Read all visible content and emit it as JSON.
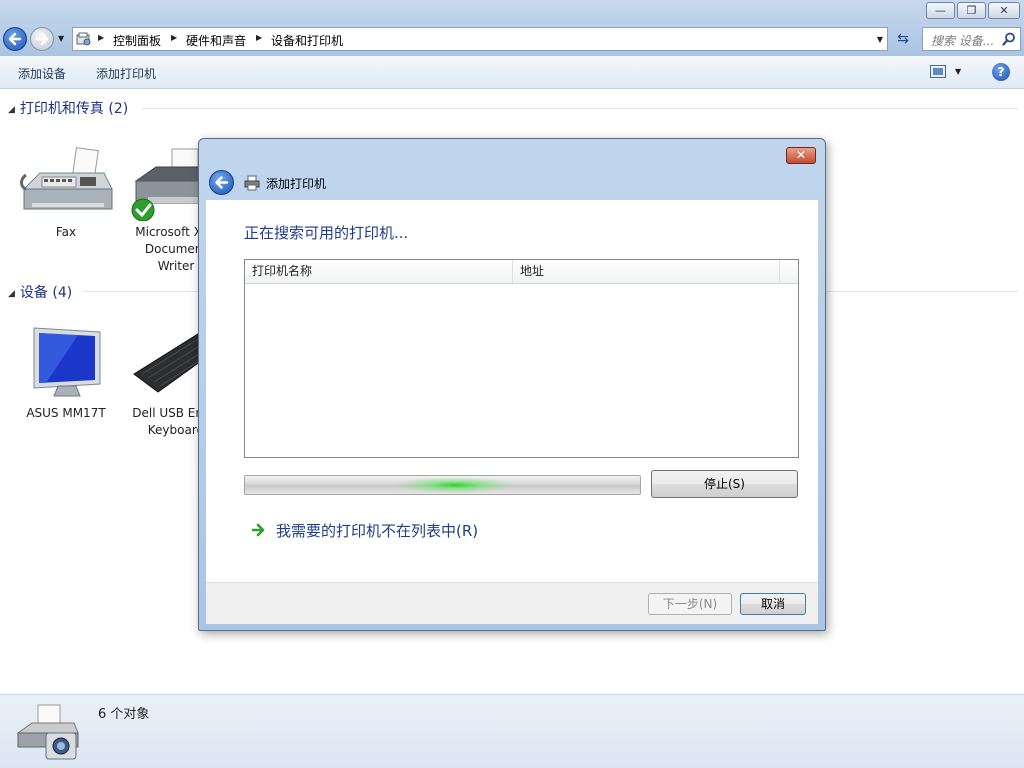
{
  "window": {
    "minimize_glyph": "—",
    "restore_glyph": "❐",
    "close_glyph": "✕"
  },
  "address_bar": {
    "breadcrumbs": [
      "控制面板",
      "硬件和声音",
      "设备和打印机"
    ],
    "search_placeholder": "搜索 设备...",
    "icons": [
      "back-arrow-icon",
      "forward-arrow-icon",
      "control-panel-icon",
      "refresh-icon",
      "search-icon"
    ]
  },
  "command_bar": {
    "add_device": "添加设备",
    "add_printer": "添加打印机",
    "help_glyph": "?"
  },
  "groups": [
    {
      "title": "打印机和传真 (2)",
      "devices": [
        {
          "label_lines": [
            "Fax"
          ],
          "icon": "fax-icon"
        },
        {
          "label_lines": [
            "Microsoft XPS",
            "Document",
            "Writer"
          ],
          "icon": "printer-icon",
          "default": true
        }
      ]
    },
    {
      "title": "设备 (4)",
      "devices": [
        {
          "label_lines": [
            "ASUS MM17T"
          ],
          "icon": "monitor-icon"
        },
        {
          "label_lines": [
            "Dell USB Entry",
            "Keyboard"
          ],
          "icon": "keyboard-icon"
        }
      ]
    }
  ],
  "status_bar": {
    "count_text": "6 个对象",
    "icon": "printer-camera-icon"
  },
  "dialog": {
    "title": "添加打印机",
    "close_glyph": "✕",
    "heading": "正在搜索可用的打印机...",
    "columns": [
      "打印机名称",
      "地址"
    ],
    "stop_button": "停止(S)",
    "missing_link": "我需要的打印机不在列表中(R)",
    "next_button": "下一步(N)",
    "cancel_button": "取消",
    "colors": {
      "heading": "#1e3e8a",
      "progress_glow": "#28d228",
      "close_button": "#c64a31"
    }
  }
}
